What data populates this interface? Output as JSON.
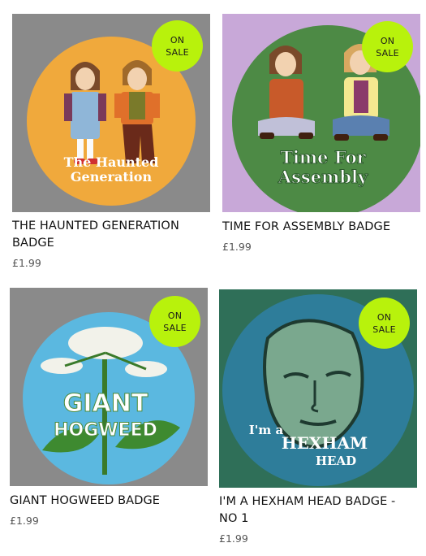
{
  "products": [
    {
      "title": "THE HAUNTED GENERATION BADGE",
      "price": "£1.99",
      "badge_line1": "ON",
      "badge_line2": "SALE",
      "artwork_text_line1": "The Haunted",
      "artwork_text_line2": "Generation",
      "colors": {
        "background": "#8a8a8a",
        "disc": "#f0a93c"
      }
    },
    {
      "title": "TIME FOR ASSEMBLY BADGE",
      "price": "£1.99",
      "badge_line1": "ON",
      "badge_line2": "SALE",
      "artwork_text_line1": "Time For",
      "artwork_text_line2": "Assembly",
      "colors": {
        "background": "#c8a8d8",
        "disc": "#4d8a45"
      }
    },
    {
      "title": "GIANT HOGWEED BADGE",
      "price": "£1.99",
      "badge_line1": "ON",
      "badge_line2": "SALE",
      "artwork_text_line1": "GIANT",
      "artwork_text_line2": "HOGWEED",
      "colors": {
        "background": "#8a8a8a",
        "disc": "#5bb8e0"
      }
    },
    {
      "title": "I'M A HEXHAM HEAD BADGE - NO 1",
      "price": "£1.99",
      "badge_line1": "ON",
      "badge_line2": "SALE",
      "artwork_text_line1": "I'm a",
      "artwork_text_line2": "HEXHAM",
      "artwork_text_line3": "HEAD",
      "colors": {
        "background": "#2f6f58",
        "disc": "#2e7d9a"
      }
    }
  ],
  "accent_color": "#b8f20c"
}
